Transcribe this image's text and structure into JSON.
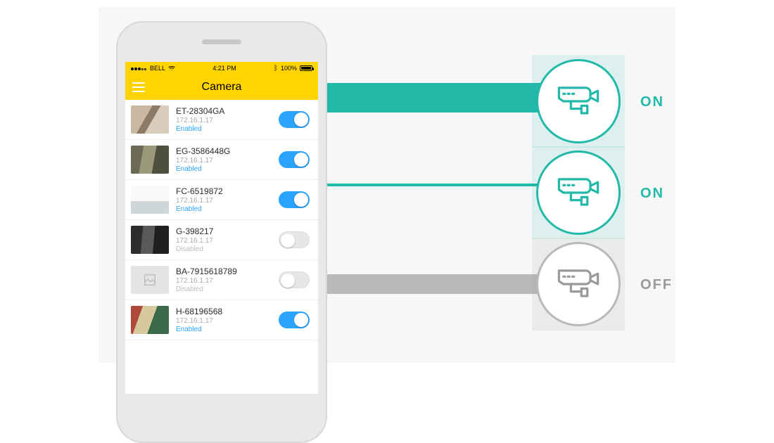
{
  "statusbar": {
    "carrier": "BELL",
    "time": "4:21 PM",
    "battery_pct": "100%"
  },
  "navbar": {
    "title": "Camera"
  },
  "states": {
    "enabled_label": "Enabled",
    "disabled_label": "Disabled"
  },
  "cameras": [
    {
      "name": "ET-28304GA",
      "ip": "172.16.1.17",
      "enabled": true
    },
    {
      "name": "EG-3586448G",
      "ip": "172.16.1.17",
      "enabled": true
    },
    {
      "name": "FC-6519872",
      "ip": "172.16.1.17",
      "enabled": true
    },
    {
      "name": "G-398217",
      "ip": "172.16.1.17",
      "enabled": false
    },
    {
      "name": "BA-7915618789",
      "ip": "172.16.1.17",
      "enabled": false
    },
    {
      "name": "H-68196568",
      "ip": "172.16.1.17",
      "enabled": true
    }
  ],
  "callouts": [
    {
      "label": "ON",
      "active": true
    },
    {
      "label": "ON",
      "active": true
    },
    {
      "label": "OFF",
      "active": false
    }
  ],
  "colors": {
    "accent_teal": "#23b9a9",
    "toggle_on": "#2aa4ff",
    "header_yellow": "#ffd400",
    "gray": "#b9b9b9"
  }
}
